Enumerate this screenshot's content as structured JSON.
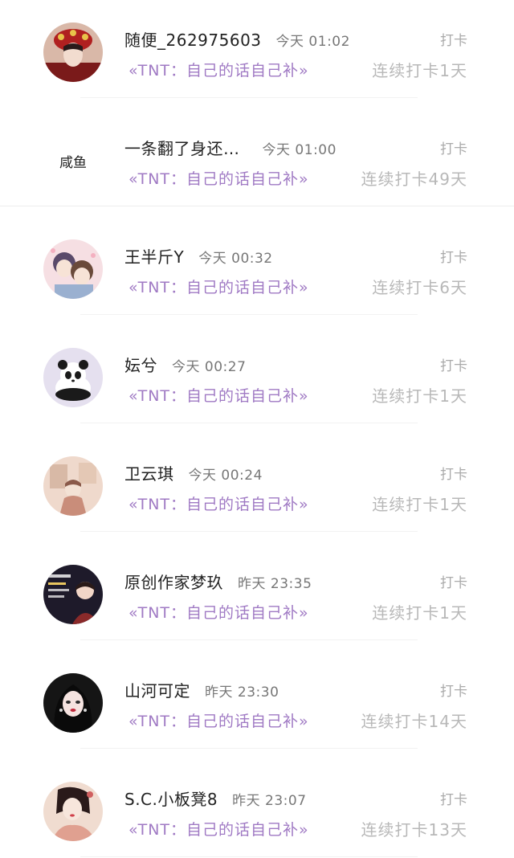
{
  "items": [
    {
      "username": "随便_262975603",
      "time": "今天 01:02",
      "book": "«TNT：自己的话自己补»",
      "action": "打卡",
      "streak": "连续打卡1天",
      "avatar": "red-headdress-portrait"
    },
    {
      "username": "一条翻了身还…",
      "time": "今天 01:00",
      "book": "«TNT：自己的话自己补»",
      "action": "打卡",
      "streak": "连续打卡49天",
      "avatar_text": "咸鱼",
      "avatar": "salted-fish-text-logo"
    },
    {
      "username": "王半斤Y",
      "time": "今天 00:32",
      "book": "«TNT：自己的话自己补»",
      "action": "打卡",
      "streak": "连续打卡6天",
      "avatar": "anime-boys-illustration"
    },
    {
      "username": "妘兮",
      "time": "今天 00:27",
      "book": "«TNT：自己的话自己补»",
      "action": "打卡",
      "streak": "连续打卡1天",
      "avatar": "panda-plush"
    },
    {
      "username": "卫云琪",
      "time": "今天 00:24",
      "book": "«TNT：自己的话自己补»",
      "action": "打卡",
      "streak": "连续打卡1天",
      "avatar": "vintage-illustration"
    },
    {
      "username": "原创作家梦玖",
      "time": "昨天 23:35",
      "book": "«TNT：自己的话自己补»",
      "action": "打卡",
      "streak": "连续打卡1天",
      "avatar": "dark-poster-girl"
    },
    {
      "username": "山河可定",
      "time": "昨天 23:30",
      "book": "«TNT：自己的话自己补»",
      "action": "打卡",
      "streak": "连续打卡14天",
      "avatar": "dark-hair-girl-portrait"
    },
    {
      "username": "S.C.小板凳8",
      "time": "昨天 23:07",
      "book": "«TNT：自己的话自己补»",
      "action": "打卡",
      "streak": "连续打卡13天",
      "avatar": "ancient-style-woman"
    }
  ]
}
